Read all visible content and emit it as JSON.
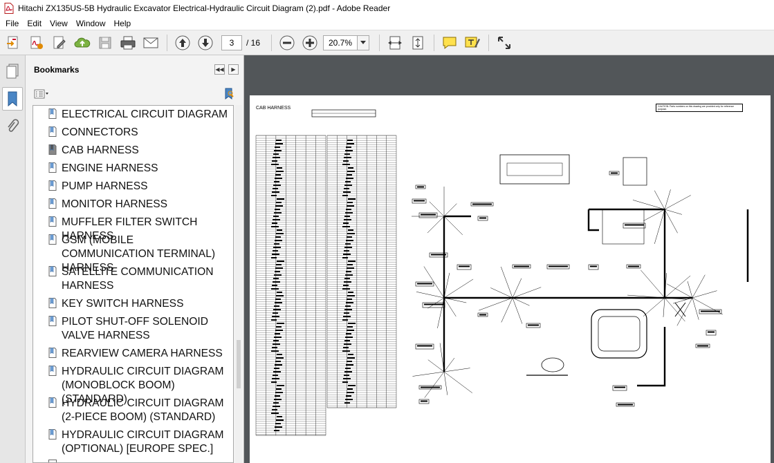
{
  "window": {
    "title": "Hitachi ZX135US-5B Hydraulic Excavator Electrical-Hydraulic Circuit Diagram (2).pdf - Adobe Reader",
    "icon": "pdf-file-icon"
  },
  "menu": [
    "File",
    "Edit",
    "View",
    "Window",
    "Help"
  ],
  "toolbar": {
    "page_current": "3",
    "page_total": "/ 16",
    "zoom": "20.7%",
    "icons": [
      "create-pdf-icon",
      "export-pdf-icon",
      "edit-pdf-icon",
      "cloud-upload-icon",
      "save-icon",
      "print-icon",
      "email-icon",
      "previous-page-icon",
      "next-page-icon",
      "zoom-out-icon",
      "zoom-in-icon",
      "fit-width-icon",
      "fit-page-icon",
      "comment-icon",
      "highlight-icon",
      "fullscreen-icon"
    ]
  },
  "sidestrip": {
    "icons": [
      "page-thumbnails-icon",
      "bookmarks-icon",
      "attachments-icon"
    ]
  },
  "bookmarks": {
    "title": "Bookmarks",
    "items": [
      {
        "label": "ELECTRICAL CIRCUIT DIAGRAM"
      },
      {
        "label": "CONNECTORS"
      },
      {
        "label": "CAB HARNESS"
      },
      {
        "label": "ENGINE HARNESS"
      },
      {
        "label": "PUMP HARNESS"
      },
      {
        "label": "MONITOR HARNESS"
      },
      {
        "label": "MUFFLER FILTER SWITCH HARNESS"
      },
      {
        "label": "GSM (MOBILE COMMUNICATION TERMINAL) HARNESS"
      },
      {
        "label": "SATELLITE COMMUNICATION HARNESS"
      },
      {
        "label": "KEY SWITCH HARNESS"
      },
      {
        "label": "PILOT SHUT-OFF SOLENOID VALVE HARNESS"
      },
      {
        "label": "REARVIEW CAMERA HARNESS"
      },
      {
        "label": "HYDRAULIC CIRCUIT DIAGRAM (MONOBLOCK BOOM) (STANDARD)"
      },
      {
        "label": "HYDRAULIC CIRCUIT DIAGRAM (2-PIECE BOOM) (STANDARD)"
      },
      {
        "label": "HYDRAULIC CIRCUIT DIAGRAM (OPTIONAL) [EUROPE SPEC.]"
      }
    ]
  },
  "document": {
    "page_heading": "CAB HARNESS",
    "caution_note": "CAUTION: Parts numbers on this drawing are provided only for reference purpose."
  },
  "colors": {
    "doc_background": "#525659",
    "panel_background": "#f3f3f3",
    "toolbar_background": "#f0f0f0",
    "pdf_red": "#c8102e"
  }
}
